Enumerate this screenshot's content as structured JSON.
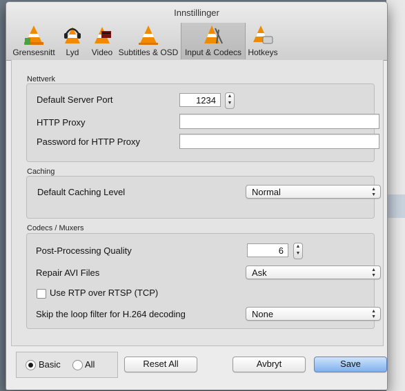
{
  "window": {
    "title": "Innstillinger"
  },
  "tabs": [
    {
      "label": "Grensesnitt",
      "icon": "vlc-cone-interface-icon"
    },
    {
      "label": "Lyd",
      "icon": "vlc-cone-headphones-icon"
    },
    {
      "label": "Video",
      "icon": "vlc-cone-video-icon"
    },
    {
      "label": "Subtitles & OSD",
      "icon": "vlc-cone-subtitles-icon"
    },
    {
      "label": "Input & Codecs",
      "icon": "vlc-cone-codecs-icon",
      "active": true
    },
    {
      "label": "Hotkeys",
      "icon": "vlc-cone-hotkeys-icon"
    }
  ],
  "network": {
    "section_title": "Nettverk",
    "server_port_label": "Default Server Port",
    "server_port_value": "1234",
    "http_proxy_label": "HTTP Proxy",
    "http_proxy_value": "",
    "proxy_password_label": "Password for HTTP Proxy",
    "proxy_password_value": ""
  },
  "caching": {
    "section_title": "Caching",
    "level_label": "Default Caching Level",
    "level_value": "Normal"
  },
  "codecs": {
    "section_title": "Codecs / Muxers",
    "pp_quality_label": "Post-Processing Quality",
    "pp_quality_value": "6",
    "repair_avi_label": "Repair AVI Files",
    "repair_avi_value": "Ask",
    "rtp_over_rtsp_label": "Use RTP over RTSP (TCP)",
    "rtp_over_rtsp_checked": false,
    "skip_loop_filter_label": "Skip the loop filter for H.264 decoding",
    "skip_loop_filter_value": "None"
  },
  "footer": {
    "mode_basic_label": "Basic",
    "mode_all_label": "All",
    "mode_selected": "Basic",
    "reset_label": "Reset All",
    "cancel_label": "Avbryt",
    "save_label": "Save"
  },
  "colors": {
    "accent_button": "#7fb1ee",
    "vlc_orange": "#f08a00"
  }
}
